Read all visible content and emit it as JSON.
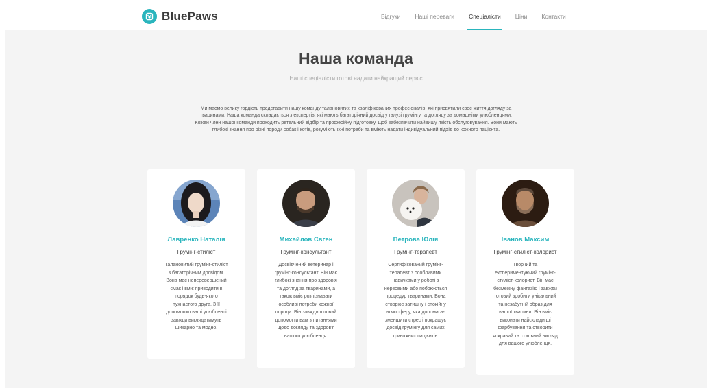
{
  "brand": {
    "name": "BluePaws",
    "logo_icon": "paw-icon",
    "accent": "#2ab5bd"
  },
  "nav": {
    "items": [
      {
        "label": "Відгуки",
        "active": false
      },
      {
        "label": "Наші переваги",
        "active": false
      },
      {
        "label": "Спеціалісти",
        "active": true
      },
      {
        "label": "Ціни",
        "active": false
      },
      {
        "label": "Контакти",
        "active": false
      }
    ]
  },
  "section": {
    "title": "Наша команда",
    "subtitle": "Наші спеціалісти готові надати найкращий сервіс",
    "intro": "Ми маємо велику гордість представити нашу команду талановитих та кваліфікованих професіоналів, які присвятили своє життя догляду за тваринами. Наша команда складається з експертів, які мають багаторічний досвід у галузі грумінгу та догляду за домашніми улюбленцями. Кожен член нашої команди проходить ретельний відбір та професійну підготовку, щоб забезпечити найвищу якість обслуговування. Вони мають глибокі знання про різні породи собак і котів, розуміють їхні потреби та вміють надати індивідуальний підхід до кожного пацієнта."
  },
  "team": [
    {
      "name": "Лавренко Наталія",
      "role": "Грумінг-стиліст",
      "description": "Талановитий грумінг-стиліст з багаторічним досвідом. Вона має неперевершений смак і вміє приводити в порядок будь-якого пухнастого друга. З її допомогою ваші улюбленці завжди виглядатимуть шикарно та модно."
    },
    {
      "name": "Михайлов Євген",
      "role": "Грумінг-консультант",
      "description": "Досвідчений ветеринар і грумінг-консультант. Він має глибокі знання про здоров'я та догляд за тваринами, а також вміє розпізнавати особливі потреби кожної породи. Він завжди готовий допомогти вам з питаннями щодо догляду та здоров'я вашого улюбленця."
    },
    {
      "name": "Петрова Юлія",
      "role": "Грумінг-терапевт",
      "description": "Сертифікований грумінг-терапевт з особливими навичками у роботі з нервовими або побоюються процедур тваринами. Вона створює затишну і спокійну атмосферу, яка допомагає зменшити стрес і покращує досвід грумінгу для самих тривожних пацієнтів."
    },
    {
      "name": "Іванов Максим",
      "role": "Грумінг-стиліст-колорист",
      "description": "Творчий та експериментуючий грумінг-стиліст-колорист. Він має безмежну фантазію і завжди готовий зробити унікальний та незабутній образ для вашої тварини. Він вміє виконати найскладніші фарбування та створити яскравий та стильний вигляд для вашого улюбленця."
    }
  ]
}
